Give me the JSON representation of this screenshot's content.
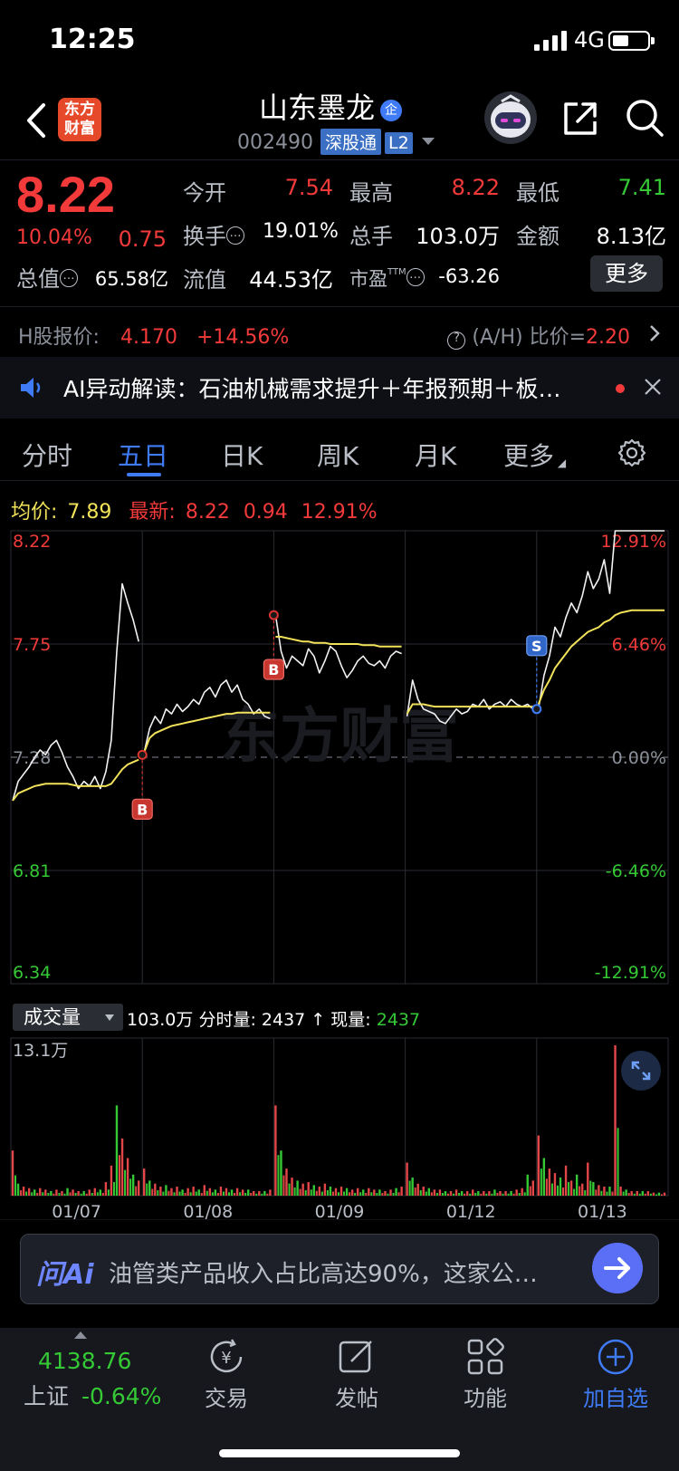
{
  "status_bar": {
    "time": "12:25",
    "network": "4G"
  },
  "header": {
    "logo_text_line1": "东方",
    "logo_text_line2": "财富",
    "stock_name": "山东墨龙",
    "badge": "企",
    "stock_code": "002490",
    "market_tag": "深股通",
    "level_tag": "L2"
  },
  "quote": {
    "price": "8.22",
    "change_pct": "10.04%",
    "change": "0.75",
    "fields": [
      {
        "label": "今开",
        "value": "7.54",
        "color": "#f23a3a"
      },
      {
        "label": "最高",
        "value": "8.22",
        "color": "#f23a3a"
      },
      {
        "label": "最低",
        "value": "7.41",
        "color": "#35c936"
      },
      {
        "label": "换手",
        "value": "19.01%",
        "color": "#ffffff"
      },
      {
        "label": "总手",
        "value": "103.0万",
        "color": "#ffffff"
      },
      {
        "label": "金额",
        "value": "8.13亿",
        "color": "#ffffff"
      },
      {
        "label": "总值",
        "value": "65.58亿",
        "color": "#ffffff"
      },
      {
        "label": "流值",
        "value": "44.53亿",
        "color": "#ffffff"
      },
      {
        "label": "市盈",
        "value": "-63.26",
        "color": "#ffffff",
        "superscript": "TTM"
      }
    ],
    "more_label": "更多"
  },
  "h_share": {
    "label": "H股报价:",
    "price": "4.170",
    "pct": "+14.56%",
    "ah_label": "(A/H) 比价=",
    "ah_value": "2.20"
  },
  "ai_banner": {
    "text": "AI异动解读：石油机械需求提升＋年报预期＋板…"
  },
  "tabs": [
    "分时",
    "五日",
    "日K",
    "周K",
    "月K",
    "更多"
  ],
  "active_tab": "五日",
  "chart_header": {
    "avg_label": "均价:",
    "avg_value": "7.89",
    "latest_label": "最新:",
    "latest_value": "8.22",
    "latest_change": "0.94",
    "latest_pct": "12.91%"
  },
  "volume_header": {
    "selector": "成交量",
    "total": "103.0万",
    "minute_label": "分时量:",
    "minute_value": "2437",
    "arrow": "↑",
    "now_label": "现量:",
    "now_value": "2437",
    "max_label": "13.1万"
  },
  "chart_data": {
    "type": "line",
    "title": "",
    "y_labels_left": [
      "8.22",
      "7.75",
      "7.28",
      "6.81",
      "6.34"
    ],
    "y_labels_right": [
      "12.91%",
      "6.46%",
      "0.00%",
      "-6.46%",
      "-12.91%"
    ],
    "ylim": [
      6.34,
      8.22
    ],
    "prev_close": 7.28,
    "x_labels": [
      "01/07",
      "01/08",
      "01/09",
      "01/12",
      "01/13"
    ],
    "days": [
      {
        "date": "01/07",
        "price": [
          7.1,
          7.18,
          7.21,
          7.24,
          7.28,
          7.31,
          7.29,
          7.33,
          7.35,
          7.3,
          7.24,
          7.2,
          7.15,
          7.18,
          7.16,
          7.2,
          7.15,
          7.22,
          7.35,
          7.72,
          8.0,
          7.92,
          7.85,
          7.76
        ],
        "avg": [
          7.1,
          7.13,
          7.14,
          7.15,
          7.16,
          7.165,
          7.17,
          7.17,
          7.17,
          7.17,
          7.17,
          7.165,
          7.16,
          7.16,
          7.16,
          7.16,
          7.16,
          7.16,
          7.17,
          7.2,
          7.23,
          7.25,
          7.26,
          7.27
        ]
      },
      {
        "date": "01/08",
        "price": [
          7.3,
          7.4,
          7.45,
          7.42,
          7.48,
          7.46,
          7.5,
          7.47,
          7.49,
          7.52,
          7.5,
          7.55,
          7.57,
          7.53,
          7.58,
          7.6,
          7.55,
          7.58,
          7.52,
          7.5,
          7.46,
          7.48,
          7.45,
          7.44
        ],
        "avg": [
          7.3,
          7.36,
          7.38,
          7.39,
          7.4,
          7.41,
          7.415,
          7.42,
          7.425,
          7.43,
          7.435,
          7.44,
          7.445,
          7.45,
          7.455,
          7.46,
          7.46,
          7.465,
          7.465,
          7.465,
          7.465,
          7.465,
          7.465,
          7.465
        ]
      },
      {
        "date": "01/09",
        "price": [
          7.87,
          7.72,
          7.65,
          7.7,
          7.68,
          7.66,
          7.73,
          7.7,
          7.63,
          7.68,
          7.74,
          7.72,
          7.66,
          7.61,
          7.64,
          7.68,
          7.7,
          7.67,
          7.66,
          7.68,
          7.65,
          7.7,
          7.72,
          7.71
        ],
        "avg": [
          7.78,
          7.78,
          7.775,
          7.77,
          7.765,
          7.76,
          7.76,
          7.755,
          7.755,
          7.755,
          7.75,
          7.75,
          7.75,
          7.75,
          7.75,
          7.75,
          7.745,
          7.745,
          7.745,
          7.74,
          7.74,
          7.74,
          7.74,
          7.74
        ]
      },
      {
        "date": "01/12",
        "price": [
          7.45,
          7.6,
          7.52,
          7.48,
          7.47,
          7.46,
          7.43,
          7.42,
          7.45,
          7.48,
          7.46,
          7.47,
          7.5,
          7.49,
          7.52,
          7.48,
          7.5,
          7.51,
          7.49,
          7.52,
          7.5,
          7.49,
          7.5,
          7.48
        ],
        "avg": [
          7.46,
          7.5,
          7.5,
          7.5,
          7.495,
          7.49,
          7.49,
          7.49,
          7.49,
          7.49,
          7.49,
          7.49,
          7.49,
          7.49,
          7.49,
          7.49,
          7.49,
          7.49,
          7.49,
          7.49,
          7.49,
          7.49,
          7.49,
          7.49
        ]
      },
      {
        "date": "01/13",
        "price": [
          7.48,
          7.62,
          7.7,
          7.82,
          7.78,
          7.86,
          7.92,
          7.88,
          7.95,
          8.05,
          7.98,
          8.02,
          8.1,
          7.96,
          8.22,
          8.22,
          8.22,
          8.22,
          8.22,
          8.22,
          8.22,
          8.22,
          8.22,
          8.22
        ],
        "avg": [
          7.5,
          7.56,
          7.6,
          7.65,
          7.68,
          7.71,
          7.74,
          7.76,
          7.78,
          7.8,
          7.81,
          7.82,
          7.84,
          7.85,
          7.87,
          7.88,
          7.885,
          7.89,
          7.89,
          7.89,
          7.89,
          7.89,
          7.89,
          7.89
        ]
      }
    ],
    "trade_marks": [
      {
        "label": "B",
        "date": "01/07",
        "price": 7.29
      },
      {
        "label": "B",
        "date": "01/08",
        "price": 7.87
      },
      {
        "label": "S",
        "date": "01/12",
        "price": 7.48
      }
    ],
    "volume": {
      "max": "13.1万",
      "days": [
        [
          30,
          8,
          6,
          5,
          4,
          5,
          4,
          3,
          4,
          3,
          5,
          4,
          3,
          3,
          4,
          5,
          4,
          9,
          20,
          60,
          38,
          25,
          14,
          10
        ],
        [
          18,
          10,
          8,
          6,
          7,
          5,
          6,
          4,
          5,
          6,
          4,
          7,
          5,
          4,
          6,
          5,
          4,
          5,
          4,
          4,
          3,
          3,
          3,
          4
        ],
        [
          60,
          30,
          18,
          12,
          10,
          8,
          9,
          7,
          6,
          8,
          6,
          5,
          6,
          5,
          4,
          5,
          4,
          5,
          4,
          4,
          3,
          4,
          5,
          6
        ],
        [
          22,
          12,
          8,
          6,
          5,
          4,
          4,
          3,
          3,
          4,
          3,
          3,
          4,
          3,
          3,
          3,
          4,
          3,
          3,
          3,
          4,
          5,
          14,
          10
        ],
        [
          40,
          25,
          18,
          15,
          12,
          20,
          10,
          14,
          8,
          22,
          9,
          7,
          6,
          6,
          100,
          6,
          4,
          3,
          3,
          3,
          3,
          2,
          2,
          2
        ]
      ]
    }
  },
  "ask_bar": {
    "logo": "问Ai",
    "text": "油管类产品收入占比高达90%，这家公…"
  },
  "bottom_nav": {
    "index_value": "4138.76",
    "index_name": "上证",
    "index_change": "-0.64%",
    "items": [
      {
        "label": "交易",
        "icon": "yuan-exchange-icon"
      },
      {
        "label": "发帖",
        "icon": "edit-post-icon"
      },
      {
        "label": "功能",
        "icon": "grid-apps-icon"
      },
      {
        "label": "加自选",
        "icon": "add-watchlist-icon"
      }
    ]
  },
  "watermark": "东方财富"
}
